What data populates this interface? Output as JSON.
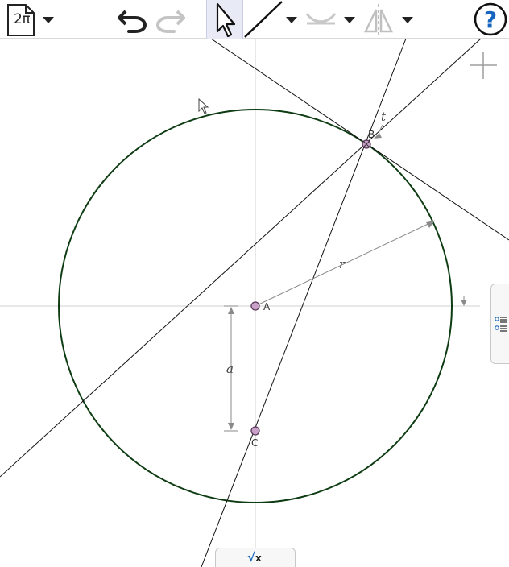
{
  "toolbar": {
    "file_label": "2π",
    "help_label": "?"
  },
  "canvas": {
    "points": {
      "a_label": "A",
      "b_label": "B",
      "c_label": "C"
    },
    "dimensions": {
      "radius_label": "r",
      "distance_label": "a",
      "tangent_label": "t"
    },
    "colors": {
      "circle": "#0d3b12",
      "point_fill": "#c8a0c8",
      "point_stroke": "#5a3a5a",
      "line": "#111111",
      "axis": "#cfcfcf"
    }
  },
  "math_keyboard": {
    "sqrt_symbol": "√",
    "x_symbol": "x"
  },
  "icons": {
    "file": "document-icon",
    "undo": "undo-icon",
    "redo": "redo-icon",
    "select": "arrow-cursor-icon",
    "line": "line-tool-icon",
    "curve": "curve-tool-icon",
    "mirror": "mirror-tool-icon",
    "help": "help-icon",
    "zoom": "crosshair-icon",
    "side_panel": "list-panel-icon",
    "cursor": "mouse-pointer-icon"
  }
}
